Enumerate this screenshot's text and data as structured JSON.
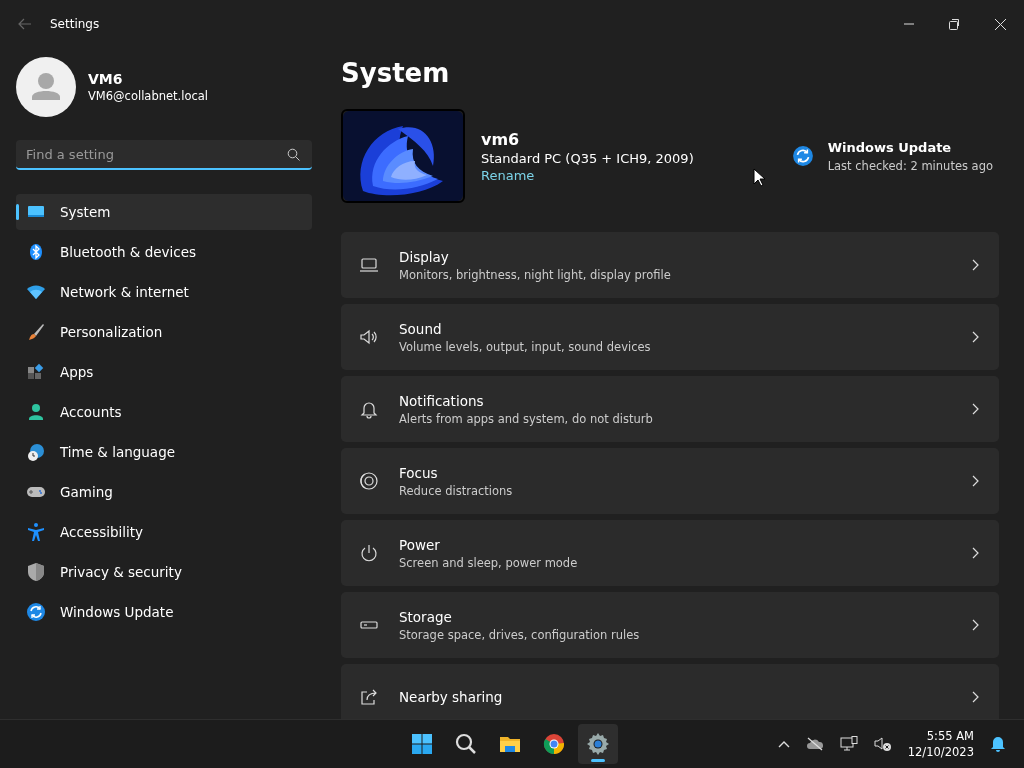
{
  "window": {
    "title": "Settings"
  },
  "account": {
    "name": "VM6",
    "email": "VM6@collabnet.local"
  },
  "search": {
    "placeholder": "Find a setting"
  },
  "sidebar": {
    "items": [
      {
        "label": "System",
        "selected": true
      },
      {
        "label": "Bluetooth & devices",
        "selected": false
      },
      {
        "label": "Network & internet",
        "selected": false
      },
      {
        "label": "Personalization",
        "selected": false
      },
      {
        "label": "Apps",
        "selected": false
      },
      {
        "label": "Accounts",
        "selected": false
      },
      {
        "label": "Time & language",
        "selected": false
      },
      {
        "label": "Gaming",
        "selected": false
      },
      {
        "label": "Accessibility",
        "selected": false
      },
      {
        "label": "Privacy & security",
        "selected": false
      },
      {
        "label": "Windows Update",
        "selected": false
      }
    ]
  },
  "page": {
    "title": "System"
  },
  "device": {
    "name": "vm6",
    "model": "Standard PC (Q35 + ICH9, 2009)",
    "rename": "Rename"
  },
  "update": {
    "title": "Windows Update",
    "status": "Last checked: 2 minutes ago"
  },
  "settings": [
    {
      "title": "Display",
      "subtitle": "Monitors, brightness, night light, display profile"
    },
    {
      "title": "Sound",
      "subtitle": "Volume levels, output, input, sound devices"
    },
    {
      "title": "Notifications",
      "subtitle": "Alerts from apps and system, do not disturb"
    },
    {
      "title": "Focus",
      "subtitle": "Reduce distractions"
    },
    {
      "title": "Power",
      "subtitle": "Screen and sleep, power mode"
    },
    {
      "title": "Storage",
      "subtitle": "Storage space, drives, configuration rules"
    },
    {
      "title": "Nearby sharing"
    }
  ],
  "taskbar": {
    "apps": [
      {
        "selected": false
      },
      {
        "selected": false
      },
      {
        "selected": false
      },
      {
        "selected": false
      },
      {
        "selected": true
      }
    ],
    "time": "5:55 AM",
    "date": "12/10/2023"
  }
}
